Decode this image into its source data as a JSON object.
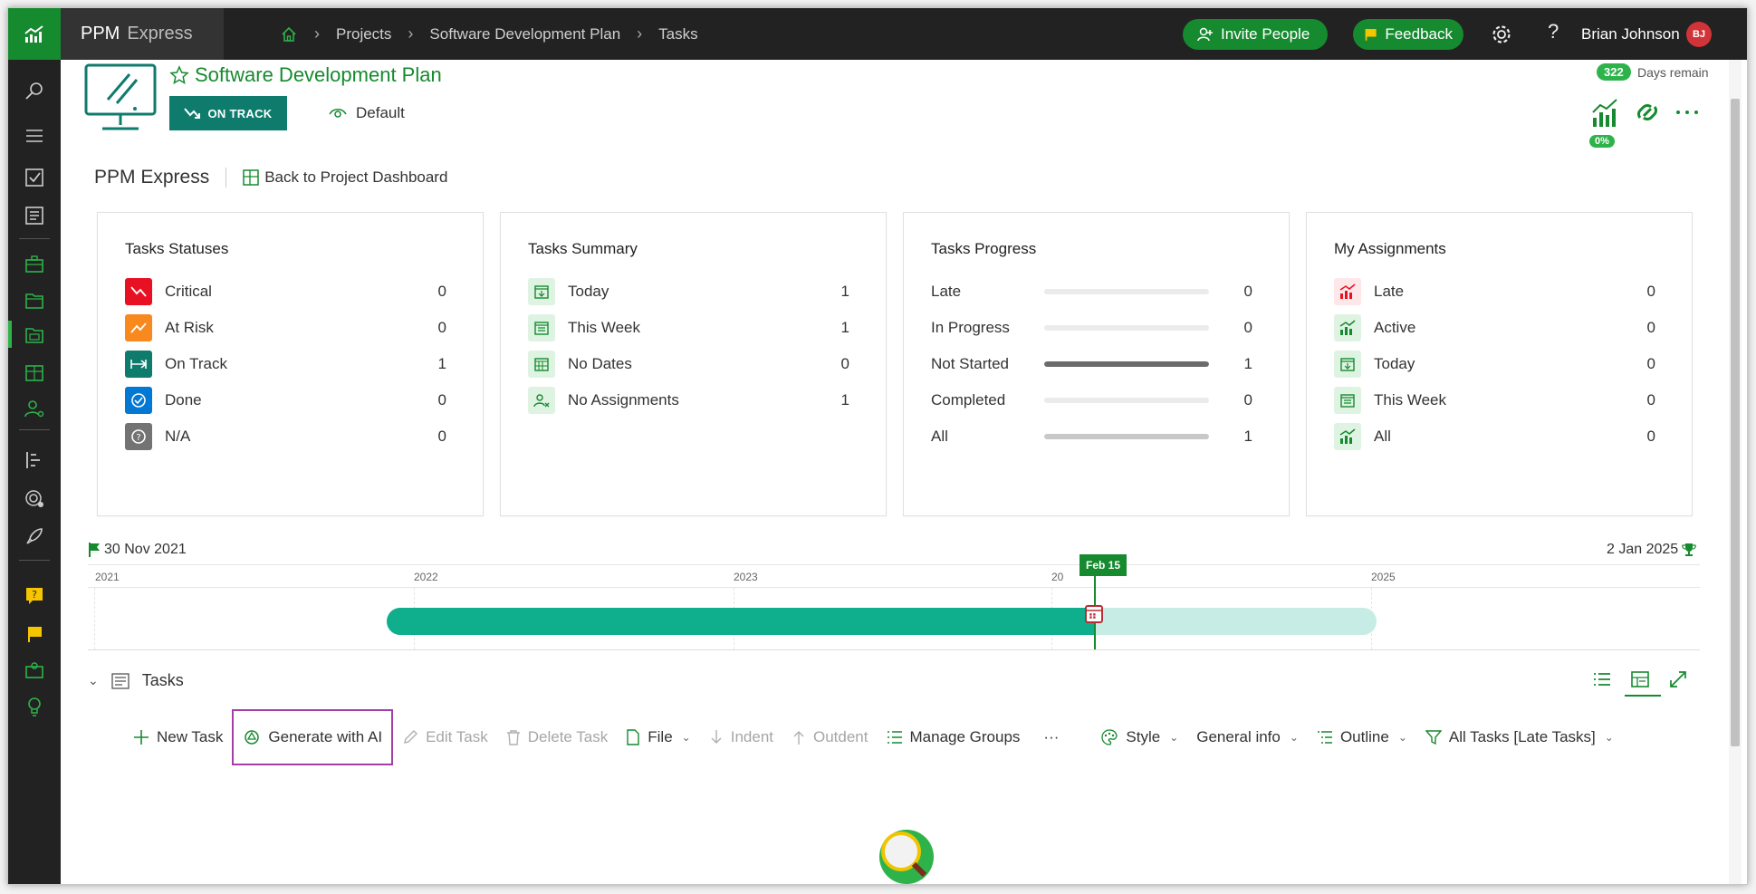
{
  "topbar": {
    "brand_primary": "PPM",
    "brand_secondary": "Express",
    "breadcrumbs": [
      "Projects",
      "Software Development Plan",
      "Tasks"
    ],
    "invite_label": "Invite People",
    "feedback_label": "Feedback",
    "user_name": "Brian Johnson",
    "user_initials": "BJ"
  },
  "project": {
    "title": "Software Development Plan",
    "status_label": "ON TRACK",
    "view_label": "Default",
    "days_remain": "322",
    "days_remain_label": "Days remain",
    "progress_pct": "0%"
  },
  "subheader": {
    "app_name": "PPM Express",
    "back_label": "Back to Project Dashboard"
  },
  "cards": {
    "statuses": {
      "title": "Tasks Statuses",
      "rows": [
        {
          "label": "Critical",
          "value": "0"
        },
        {
          "label": "At Risk",
          "value": "0"
        },
        {
          "label": "On Track",
          "value": "1"
        },
        {
          "label": "Done",
          "value": "0"
        },
        {
          "label": "N/A",
          "value": "0"
        }
      ]
    },
    "summary": {
      "title": "Tasks Summary",
      "rows": [
        {
          "label": "Today",
          "value": "1"
        },
        {
          "label": "This Week",
          "value": "1"
        },
        {
          "label": "No Dates",
          "value": "0"
        },
        {
          "label": "No Assignments",
          "value": "1"
        }
      ]
    },
    "progress": {
      "title": "Tasks Progress",
      "rows": [
        {
          "label": "Late",
          "value": "0",
          "fraction": 0
        },
        {
          "label": "In Progress",
          "value": "0",
          "fraction": 0
        },
        {
          "label": "Not Started",
          "value": "1",
          "fraction": 1
        },
        {
          "label": "Completed",
          "value": "0",
          "fraction": 0
        },
        {
          "label": "All",
          "value": "1",
          "fraction": 1
        }
      ]
    },
    "assignments": {
      "title": "My Assignments",
      "rows": [
        {
          "label": "Late",
          "value": "0"
        },
        {
          "label": "Active",
          "value": "0"
        },
        {
          "label": "Today",
          "value": "0"
        },
        {
          "label": "This Week",
          "value": "0"
        },
        {
          "label": "All",
          "value": "0"
        }
      ]
    }
  },
  "timeline": {
    "start_date": "30 Nov 2021",
    "end_date": "2 Jan 2025",
    "years": [
      "2021",
      "2022",
      "2023",
      "20",
      "2025"
    ],
    "today_label": "Feb 15"
  },
  "tasks": {
    "section_title": "Tasks",
    "toolbar": {
      "new_task": "New Task",
      "generate_ai": "Generate with AI",
      "edit_task": "Edit Task",
      "delete_task": "Delete Task",
      "file": "File",
      "indent": "Indent",
      "outdent": "Outdent",
      "manage_groups": "Manage Groups",
      "more": "···",
      "style": "Style",
      "general_info": "General info",
      "outline": "Outline",
      "filter": "All Tasks [Late Tasks]"
    }
  },
  "colors": {
    "brand_green": "#158a2e",
    "on_track_teal": "#0f7b6c",
    "critical_red": "#e81123",
    "at_risk_orange": "#f7891f",
    "done_blue": "#0078d4",
    "highlight_purple": "#a23fa6"
  }
}
